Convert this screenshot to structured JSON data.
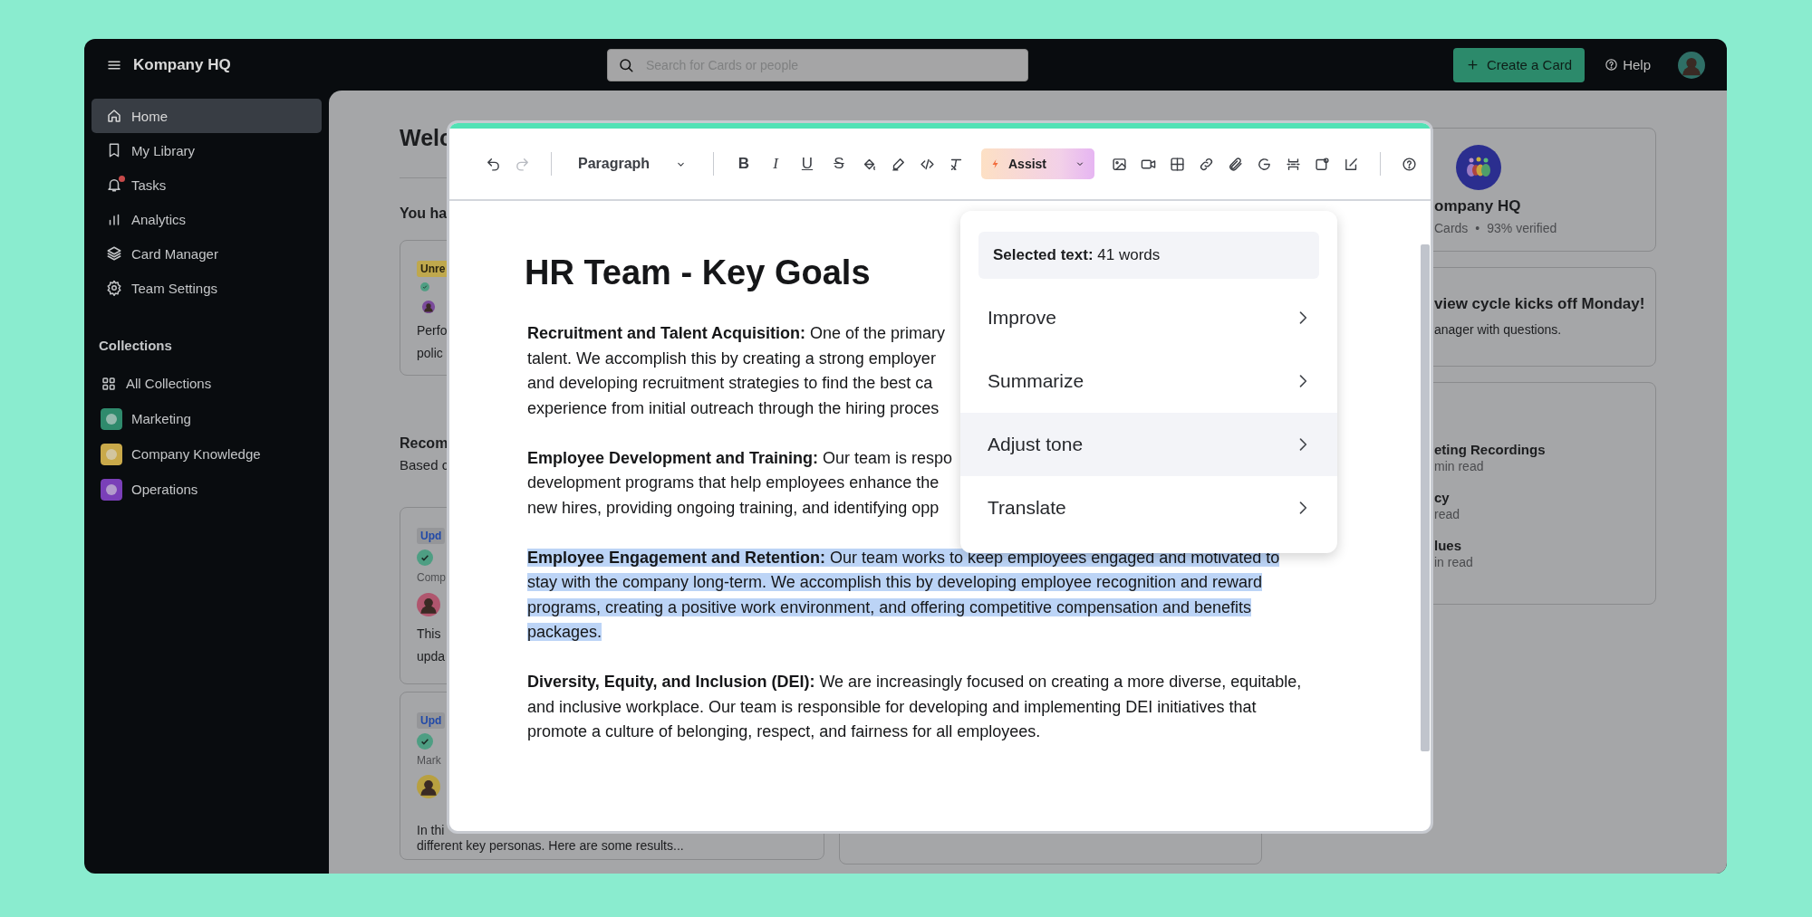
{
  "app": {
    "title": "Kompany HQ"
  },
  "search": {
    "placeholder": "Search for Cards or people"
  },
  "create_button": "Create a Card",
  "help": "Help",
  "sidebar": {
    "items": [
      {
        "label": "Home",
        "selected": true,
        "notification": false
      },
      {
        "label": "My Library",
        "selected": false,
        "notification": false
      },
      {
        "label": "Tasks",
        "selected": false,
        "notification": true
      },
      {
        "label": "Analytics",
        "selected": false,
        "notification": false
      },
      {
        "label": "Card Manager",
        "selected": false,
        "notification": false
      },
      {
        "label": "Team Settings",
        "selected": false,
        "notification": false
      }
    ],
    "collections_title": "Collections",
    "collections": [
      {
        "label": "All Collections",
        "kind": "grid"
      },
      {
        "label": "Marketing",
        "kind": "collection",
        "color": "#2f8a6c"
      },
      {
        "label": "Company Knowledge",
        "kind": "collection",
        "color": "#c9a94a"
      },
      {
        "label": "Operations",
        "kind": "collection",
        "color": "#7a3fb8"
      }
    ]
  },
  "home": {
    "heading": "Welc",
    "subheading": "You ha",
    "section_title": "Recom",
    "section_subtitle": "Based c",
    "left_cards": [
      {
        "badge": {
          "text": "Unre",
          "kind": "unread"
        },
        "lines": [
          "Perfo",
          "polic"
        ]
      },
      {
        "badge": {
          "text": "Upd",
          "kind": "updated"
        },
        "meta": "Comp",
        "lines": [
          "This",
          "upda"
        ]
      },
      {
        "badge": {
          "text": "Upd",
          "kind": "updated"
        },
        "meta": "Mark",
        "lines": [
          "In thi",
          "different key personas. Here are some results..."
        ]
      }
    ],
    "right_cards": [
      {
        "kind": "collection",
        "title": "ompany HQ",
        "stats": [
          "Cards",
          "93% verified"
        ],
        "separator": "•"
      },
      {
        "kind": "announcement",
        "title": "view cycle kicks off Monday!",
        "body": "anager with questions."
      },
      {
        "kind": "list",
        "items": [
          {
            "title": "eting Recordings",
            "meta": "min read"
          },
          {
            "title": "cy",
            "meta": "read"
          },
          {
            "title": "lues",
            "meta": "in read"
          }
        ]
      }
    ]
  },
  "editor": {
    "toolbar": {
      "undo": {
        "disabled": false
      },
      "redo": {
        "disabled": true
      },
      "block_style": "Paragraph",
      "format_buttons": [
        {
          "label": "B"
        },
        {
          "label": "I"
        },
        {
          "label": "U"
        },
        {
          "label": "S"
        }
      ],
      "assist": "Assist"
    },
    "document": {
      "title": "HR Team - Key Goals",
      "paragraphs": [
        {
          "lines": [
            "**Recruitment and Talent Acquisition:** One of the primary",
            "talent. We accomplish this by creating a strong employer",
            "and developing recruitment strategies to find the best ca",
            "experience from initial outreach through the hiring proces"
          ],
          "selected": false
        },
        {
          "lines": [
            "**Employee Development and Training:** Our team is respo",
            "development programs that help employees enhance the",
            "new hires, providing ongoing training, and identifying opp"
          ],
          "selected": false
        },
        {
          "text": "**Employee Engagement and Retention:** Our team works to keep employees engaged and motivated to stay with the company long-term. We accomplish this by developing employee recognition and reward programs, creating a positive work environment, and offering competitive compensation and benefits packages.",
          "selected": true
        },
        {
          "text": "**Diversity, Equity, and Inclusion (DEI):** We are increasingly focused on creating a more diverse, equitable, and inclusive workplace. Our team is responsible for developing and implementing DEI initiatives that promote a culture of belonging, respect, and fairness for all employees.",
          "selected": false
        }
      ]
    },
    "assist_menu": {
      "summary": "**Selected text:** 41 words",
      "items": [
        {
          "label": "Improve",
          "selected": false
        },
        {
          "label": "Summarize",
          "selected": false
        },
        {
          "label": "Adjust tone",
          "selected": true
        },
        {
          "label": "Translate",
          "selected": false
        }
      ]
    }
  }
}
